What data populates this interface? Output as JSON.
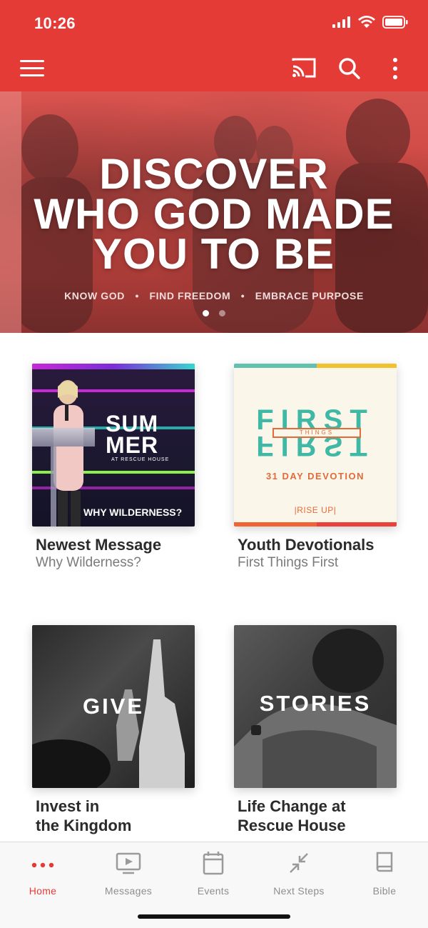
{
  "status_bar": {
    "time": "10:26"
  },
  "app_bar": {
    "icons": [
      "menu-icon",
      "cast-icon",
      "search-icon",
      "more-vert-icon"
    ],
    "accent_color": "#e43b37"
  },
  "hero": {
    "title_line1": "DISCOVER",
    "title_line2": "WHO GOD MADE",
    "title_line3": "YOU TO BE",
    "tag1": "KNOW GOD",
    "tag2": "FIND FREEDOM",
    "tag3": "EMBRACE PURPOSE",
    "separator": "•",
    "pager": {
      "count": 2,
      "active": 1
    }
  },
  "cards": [
    {
      "title": "Newest Message",
      "subtitle": "Why Wilderness?",
      "art": {
        "word1": "SUM",
        "word2": "MER",
        "small": "AT RESCUE HOUSE",
        "caption": "WHY WILDERNESS?"
      }
    },
    {
      "title": "Youth Devotionals",
      "subtitle": "First Things First",
      "art": {
        "word": "FIRST",
        "things": "THINGS",
        "devotion": "31 DAY DEVOTION",
        "brand": "|RISE UP|"
      }
    },
    {
      "title_line1": "Invest in",
      "title_line2": "the Kingdom",
      "art": {
        "word": "GIVE"
      }
    },
    {
      "title_line1": "Life Change at",
      "title_line2": "Rescue House",
      "art": {
        "word": "STORIES"
      }
    }
  ],
  "tabs": [
    {
      "label": "Home",
      "icon": "home-dots-icon",
      "active": true
    },
    {
      "label": "Messages",
      "icon": "play-screen-icon",
      "active": false
    },
    {
      "label": "Events",
      "icon": "calendar-icon",
      "active": false
    },
    {
      "label": "Next Steps",
      "icon": "arrows-icon",
      "active": false
    },
    {
      "label": "Bible",
      "icon": "book-icon",
      "active": false
    }
  ]
}
